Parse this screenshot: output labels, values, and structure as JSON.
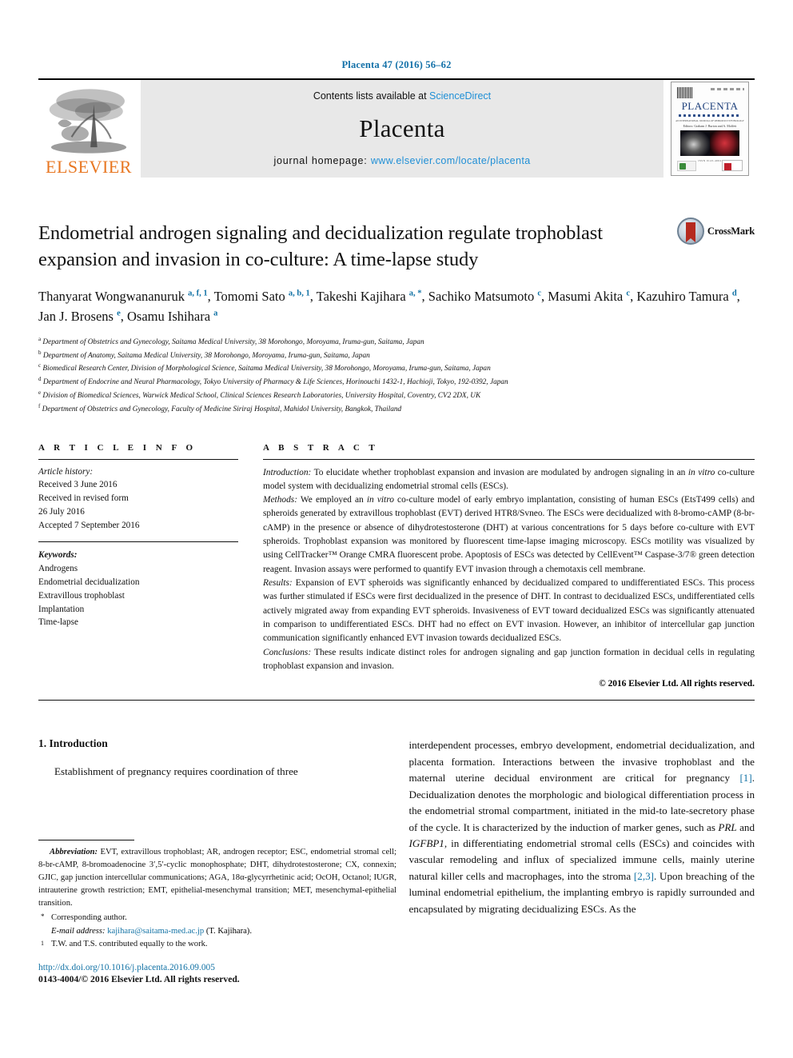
{
  "running_head": "Placenta 47 (2016) 56–62",
  "masthead": {
    "publisher_logo_label": "ELSEVIER",
    "contents_prefix": "Contents lists available at ",
    "contents_link": "ScienceDirect",
    "journal_name": "Placenta",
    "homepage_prefix": "journal homepage: ",
    "homepage_url": "www.elsevier.com/locate/placenta",
    "cover": {
      "title": "PLACENTA",
      "subtitle": "AN INTERNATIONAL JOURNAL OF REPRODUCTIVE BIOLOGY",
      "tagline": "Editors: Graham J. Burton and A. Moffett",
      "caption": "ISSN 0143-4004"
    }
  },
  "article": {
    "title": "Endometrial androgen signaling and decidualization regulate trophoblast expansion and invasion in co-culture: A time-lapse study",
    "crossmark_label": "CrossMark",
    "authors": [
      {
        "name": "Thanyarat Wongwananuruk",
        "sup": "a, f, 1",
        "sep": ", "
      },
      {
        "name": "Tomomi Sato",
        "sup": "a, b, 1",
        "sep": ", "
      },
      {
        "name": "Takeshi Kajihara",
        "sup": "a, *",
        "sep": ", "
      },
      {
        "name": "Sachiko Matsumoto",
        "sup": "c",
        "sep": ", "
      },
      {
        "name": "Masumi Akita",
        "sup": "c",
        "sep": ", "
      },
      {
        "name": "Kazuhiro Tamura",
        "sup": "d",
        "sep": ", "
      },
      {
        "name": "Jan J. Brosens",
        "sup": "e",
        "sep": ", "
      },
      {
        "name": "Osamu Ishihara",
        "sup": "a",
        "sep": ""
      }
    ],
    "affiliations": [
      {
        "mark": "a",
        "text": "Department of Obstetrics and Gynecology, Saitama Medical University, 38 Morohongo, Moroyama, Iruma-gun, Saitama, Japan"
      },
      {
        "mark": "b",
        "text": "Department of Anatomy, Saitama Medical University, 38 Morohongo, Moroyama, Iruma-gun, Saitama, Japan"
      },
      {
        "mark": "c",
        "text": "Biomedical Research Center, Division of Morphological Science, Saitama Medical University, 38 Morohongo, Moroyama, Iruma-gun, Saitama, Japan"
      },
      {
        "mark": "d",
        "text": "Department of Endocrine and Neural Pharmacology, Tokyo University of Pharmacy & Life Sciences, Horinouchi 1432-1, Hachioji, Tokyo, 192-0392, Japan"
      },
      {
        "mark": "e",
        "text": "Division of Biomedical Sciences, Warwick Medical School, Clinical Sciences Research Laboratories, University Hospital, Coventry, CV2 2DX, UK"
      },
      {
        "mark": "f",
        "text": "Department of Obstetrics and Gynecology, Faculty of Medicine Siriraj Hospital, Mahidol University, Bangkok, Thailand"
      }
    ]
  },
  "article_info": {
    "heading": "A R T I C L E  I N F O",
    "history_label": "Article history:",
    "history": [
      "Received 3 June 2016",
      "Received in revised form",
      "26 July 2016",
      "Accepted 7 September 2016"
    ],
    "keywords_label": "Keywords:",
    "keywords": [
      "Androgens",
      "Endometrial decidualization",
      "Extravillous trophoblast",
      "Implantation",
      "Time-lapse"
    ]
  },
  "abstract": {
    "heading": "A B S T R A C T",
    "sections": [
      {
        "label": "Introduction:",
        "text": " To elucidate whether trophoblast expansion and invasion are modulated by androgen signaling in an in vitro co-culture model system with decidualizing endometrial stromal cells (ESCs)."
      },
      {
        "label": "Methods:",
        "text": " We employed an in vitro co-culture model of early embryo implantation, consisting of human ESCs (EtsT499 cells) and spheroids generated by extravillous trophoblast (EVT) derived HTR8/Svneo. The ESCs were decidualized with 8-bromo-cAMP (8-br-cAMP) in the presence or absence of dihydrotestosterone (DHT) at various concentrations for 5 days before co-culture with EVT spheroids. Trophoblast expansion was monitored by fluorescent time-lapse imaging microscopy. ESCs motility was visualized by using CellTracker™ Orange CMRA fluorescent probe. Apoptosis of ESCs was detected by CellEvent™ Caspase-3/7® green detection reagent. Invasion assays were performed to quantify EVT invasion through a chemotaxis cell membrane."
      },
      {
        "label": "Results:",
        "text": " Expansion of EVT spheroids was significantly enhanced by decidualized compared to undifferentiated ESCs. This process was further stimulated if ESCs were first decidualized in the presence of DHT. In contrast to decidualized ESCs, undifferentiated cells actively migrated away from expanding EVT spheroids. Invasiveness of EVT toward decidualized ESCs was significantly attenuated in comparison to undifferentiated ESCs. DHT had no effect on EVT invasion. However, an inhibitor of intercellular gap junction communication significantly enhanced EVT invasion towards decidualized ESCs."
      },
      {
        "label": "Conclusions:",
        "text": " These results indicate distinct roles for androgen signaling and gap junction formation in decidual cells in regulating trophoblast expansion and invasion."
      }
    ],
    "copyright": "© 2016 Elsevier Ltd. All rights reserved."
  },
  "body": {
    "section_number_title": "1. Introduction",
    "left_paragraph": "Establishment of pregnancy requires coordination of three",
    "right_paragraph_pre": "interdependent processes, embryo development, endometrial decidualization, and placenta formation. Interactions between the invasive trophoblast and the maternal uterine decidual environment are critical for pregnancy ",
    "ref1": "[1]",
    "right_paragraph_mid": ". Decidualization denotes the morphologic and biological differentiation process in the endometrial stromal compartment, initiated in the mid-to late-secretory phase of the cycle. It is characterized by the induction of marker genes, such as PRL and IGFBP1, in differentiating endometrial stromal cells (ESCs) and coincides with vascular remodeling and influx of specialized immune cells, mainly uterine natural killer cells and macrophages, into the stroma ",
    "ref2": "[2,3]",
    "right_paragraph_post": ". Upon breaching of the luminal endometrial epithelium, the implanting embryo is rapidly surrounded and encapsulated by migrating decidualizing ESCs. As the"
  },
  "footnotes": {
    "abbrev_label": "Abbreviation:",
    "abbrev_text": " EVT, extravillous trophoblast; AR, androgen receptor; ESC, endometrial stromal cell; 8-br-cAMP, 8-bromoadenocine 3′,5′-cyclic monophosphate; DHT, dihydrotestosterone; CX, connexin; GJIC, gap junction intercellular communications; AGA, 18α-glycyrrhetinic acid; OcOH, Octanol; IUGR, intrauterine growth restriction; EMT, epithelial-mesenchymal transition; MET, mesenchymal-epithelial transition.",
    "corresponding_mark": "*",
    "corresponding_text": "Corresponding author.",
    "email_label": "E-mail address:",
    "email": "kajihara@saitama-med.ac.jp",
    "email_suffix": " (T. Kajihara).",
    "equal_mark": "1",
    "equal_text": "T.W. and T.S. contributed equally to the work."
  },
  "footer": {
    "doi": "http://dx.doi.org/10.1016/j.placenta.2016.09.005",
    "issn_line": "0143-4004/© 2016 Elsevier Ltd. All rights reserved."
  }
}
